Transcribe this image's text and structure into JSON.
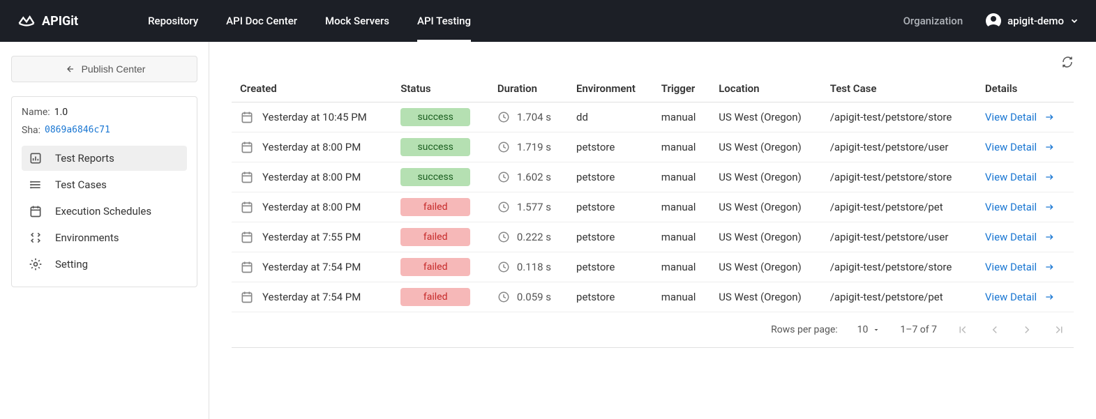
{
  "header": {
    "brand": "APIGit",
    "nav": [
      {
        "label": "Repository",
        "active": false
      },
      {
        "label": "API Doc Center",
        "active": false
      },
      {
        "label": "Mock Servers",
        "active": false
      },
      {
        "label": "API Testing",
        "active": true
      }
    ],
    "organization_label": "Organization",
    "user_label": "apigit-demo"
  },
  "sidebar": {
    "publish_label": "Publish Center",
    "meta": {
      "name_label": "Name:",
      "name_value": "1.0",
      "sha_label": "Sha:",
      "sha_value": "0869a6846c71"
    },
    "items": [
      {
        "label": "Test Reports",
        "active": true
      },
      {
        "label": "Test Cases",
        "active": false
      },
      {
        "label": "Execution Schedules",
        "active": false
      },
      {
        "label": "Environments",
        "active": false
      },
      {
        "label": "Setting",
        "active": false
      }
    ]
  },
  "table": {
    "headers": {
      "created": "Created",
      "status": "Status",
      "duration": "Duration",
      "environment": "Environment",
      "trigger": "Trigger",
      "location": "Location",
      "testcase": "Test Case",
      "details": "Details"
    },
    "detail_link_label": "View Detail",
    "rows": [
      {
        "created": "Yesterday at 10:45 PM",
        "status": "success",
        "duration": "1.704 s",
        "environment": "dd",
        "trigger": "manual",
        "location": "US West (Oregon)",
        "testcase": "/apigit-test/petstore/store"
      },
      {
        "created": "Yesterday at 8:00 PM",
        "status": "success",
        "duration": "1.719 s",
        "environment": "petstore",
        "trigger": "manual",
        "location": "US West (Oregon)",
        "testcase": "/apigit-test/petstore/user"
      },
      {
        "created": "Yesterday at 8:00 PM",
        "status": "success",
        "duration": "1.602 s",
        "environment": "petstore",
        "trigger": "manual",
        "location": "US West (Oregon)",
        "testcase": "/apigit-test/petstore/store"
      },
      {
        "created": "Yesterday at 8:00 PM",
        "status": "failed",
        "duration": "1.577 s",
        "environment": "petstore",
        "trigger": "manual",
        "location": "US West (Oregon)",
        "testcase": "/apigit-test/petstore/pet"
      },
      {
        "created": "Yesterday at 7:55 PM",
        "status": "failed",
        "duration": "0.222 s",
        "environment": "petstore",
        "trigger": "manual",
        "location": "US West (Oregon)",
        "testcase": "/apigit-test/petstore/user"
      },
      {
        "created": "Yesterday at 7:54 PM",
        "status": "failed",
        "duration": "0.118 s",
        "environment": "petstore",
        "trigger": "manual",
        "location": "US West (Oregon)",
        "testcase": "/apigit-test/petstore/store"
      },
      {
        "created": "Yesterday at 7:54 PM",
        "status": "failed",
        "duration": "0.059 s",
        "environment": "petstore",
        "trigger": "manual",
        "location": "US West (Oregon)",
        "testcase": "/apigit-test/petstore/pet"
      }
    ]
  },
  "pagination": {
    "rows_per_page_label": "Rows per page:",
    "rows_per_page_value": "10",
    "range": "1–7 of 7"
  }
}
